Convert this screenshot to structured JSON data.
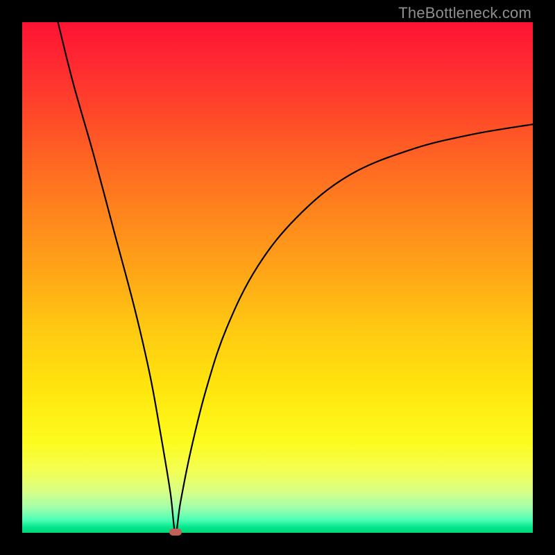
{
  "watermark": "TheBottleneck.com",
  "colors": {
    "frame": "#000000",
    "curve": "#000000",
    "marker": "#c06058"
  },
  "chart_data": {
    "type": "line",
    "title": "",
    "xlabel": "",
    "ylabel": "",
    "xlim": [
      0,
      100
    ],
    "ylim": [
      0,
      100
    ],
    "grid": false,
    "legend": false,
    "annotations": [
      {
        "kind": "marker",
        "x": 30,
        "y": 0,
        "shape": "pill",
        "color": "#c06058"
      }
    ],
    "curve_note": "V-shaped bottleneck curve: sharp minimum near x≈30, steep left arm, concave right arm approaching ~80 at x=100. No numeric axis ticks are shown; values are position estimates.",
    "series": [
      {
        "name": "bottleneck-curve",
        "x": [
          7,
          10,
          14,
          18,
          22,
          25,
          27,
          29,
          30,
          31,
          33,
          36,
          40,
          46,
          54,
          64,
          76,
          88,
          100
        ],
        "values": [
          100,
          88,
          74,
          59,
          44,
          31,
          20,
          8,
          0,
          6,
          16,
          28,
          40,
          52,
          62,
          70,
          75,
          78,
          80
        ]
      }
    ]
  }
}
